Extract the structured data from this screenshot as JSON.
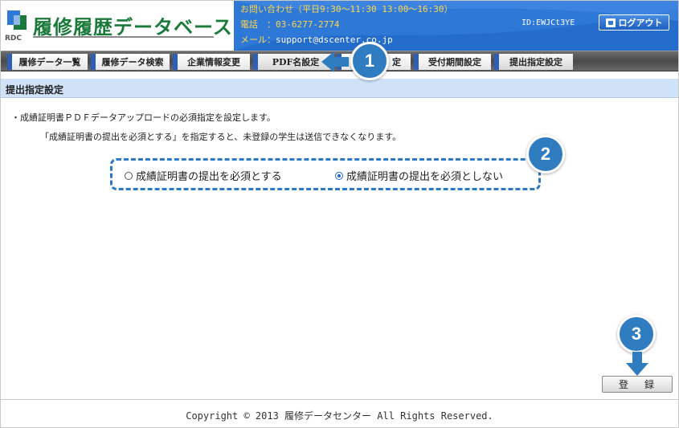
{
  "header": {
    "logo_text": "RDC",
    "app_title": "履修履歴データベース",
    "contact_hours": "お問い合わせ（平日9:30～11:30 13:00～16:30）",
    "phone_label": "電話　：",
    "phone": "03-6277-2774",
    "mail_label": "メール：",
    "email": "support@dscenter.co.jp",
    "user_id": "ID:EWJCt3YE",
    "logout_label": "ログアウト"
  },
  "nav": {
    "tabs": [
      {
        "label": "履修データ一覧"
      },
      {
        "label": "履修データ検索"
      },
      {
        "label": "企業情報変更"
      },
      {
        "label": "PDF名設定"
      },
      {
        "label": "定"
      },
      {
        "label": "受付期間設定"
      },
      {
        "label": "提出指定設定"
      }
    ]
  },
  "main": {
    "section_title": "提出指定設定",
    "description_1": "・成績証明書ＰＤＦデータアップロードの必須指定を設定します。",
    "description_2": "「成績証明書の提出を必須とする」を指定すると、未登録の学生は送信できなくなります。",
    "options": [
      {
        "label": "成績証明書の提出を必須とする",
        "selected": false
      },
      {
        "label": "成績証明書の提出を必須としない",
        "selected": true
      }
    ],
    "register_label": "登録"
  },
  "markers": [
    "1",
    "2",
    "3"
  ],
  "footer": {
    "copyright": "Copyright © 2013 履修データセンター All Rights Reserved."
  },
  "colors": {
    "header_blue": "#2e78d8",
    "marker_blue": "#2f7cc0",
    "section_bg": "#cfe2f8",
    "title_green": "#1a7a3a"
  }
}
